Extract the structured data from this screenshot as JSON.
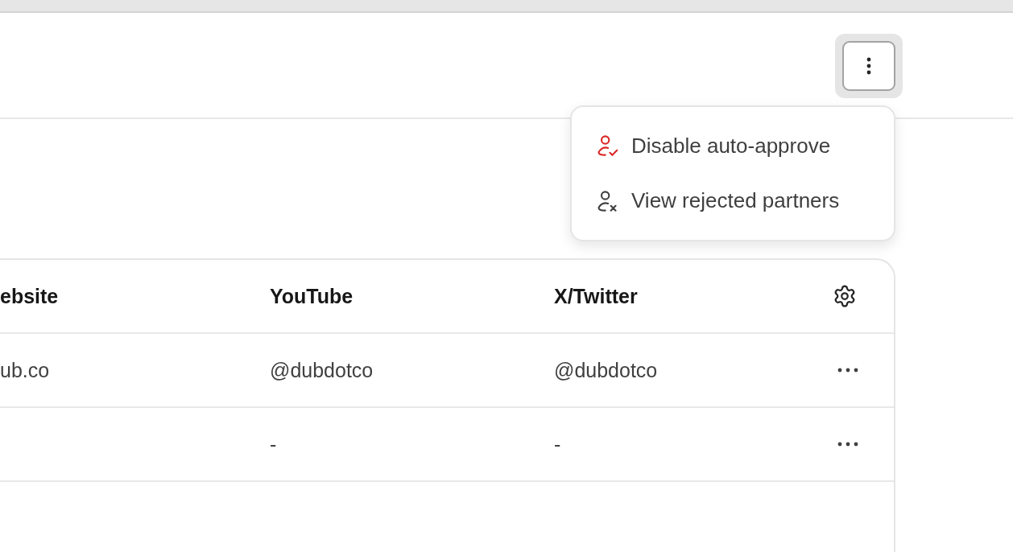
{
  "header": {
    "more_button": {
      "open": true
    }
  },
  "menu": {
    "items": [
      {
        "label": "Disable auto-approve",
        "kind": "user-check"
      },
      {
        "label": "View rejected partners",
        "kind": "user-x"
      }
    ]
  },
  "table": {
    "columns": [
      "ebsite",
      "YouTube",
      "X/Twitter"
    ],
    "rows": [
      {
        "cells": [
          "ub.co",
          "@dubdotco",
          "@dubdotco"
        ]
      },
      {
        "cells": [
          null,
          "-",
          "-"
        ]
      }
    ]
  }
}
